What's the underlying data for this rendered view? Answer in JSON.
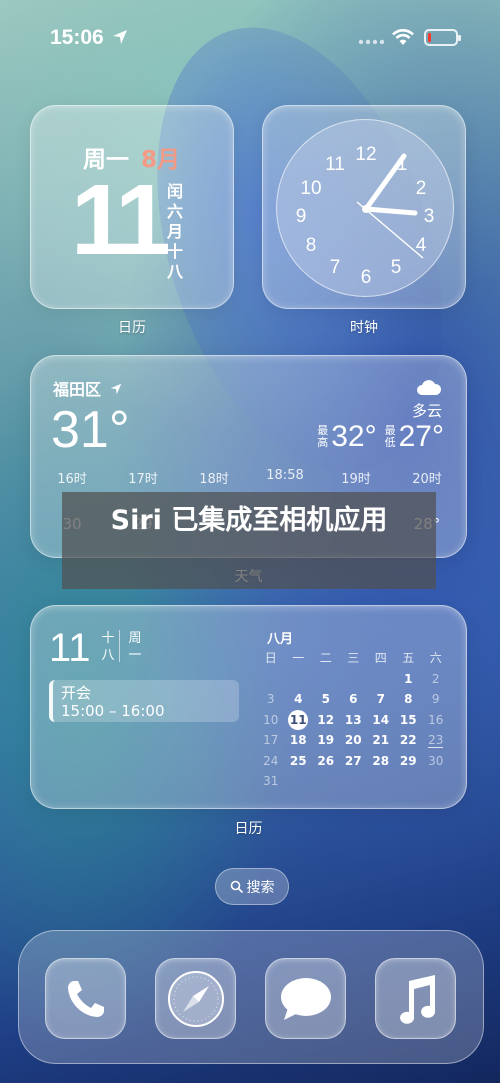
{
  "status_bar": {
    "time": "15:06"
  },
  "calendar_widget": {
    "weekday": "周一",
    "month": "8月",
    "day": "11",
    "lunar": [
      "闰",
      "六",
      "月",
      "十",
      "八"
    ],
    "label": "日历"
  },
  "clock_widget": {
    "numbers": [
      "12",
      "1",
      "2",
      "3",
      "4",
      "5",
      "6",
      "7",
      "8",
      "9",
      "10",
      "11"
    ],
    "label": "时钟"
  },
  "weather_widget": {
    "city": "福田区",
    "temperature": "31°",
    "condition": "多云",
    "high_tag": "最高",
    "high": "32°",
    "low_tag": "最低",
    "low": "27°",
    "hours": [
      {
        "time": "16时",
        "temp": "30"
      },
      {
        "time": "17时",
        "temp": "29"
      },
      {
        "time": "18时",
        "temp": ""
      },
      {
        "time": "18:58",
        "temp": ""
      },
      {
        "time": "19时",
        "temp": ""
      },
      {
        "time": "20时",
        "temp": "28°"
      }
    ],
    "label": "天气"
  },
  "banner": {
    "text": "Siri 已集成至相机应用"
  },
  "calendar_large": {
    "day": "11",
    "lunar": [
      "十",
      "八"
    ],
    "week": [
      "周",
      "一"
    ],
    "event_title": "开会",
    "event_time": "15:00 – 16:00",
    "month": "八月",
    "headers": [
      "日",
      "一",
      "二",
      "三",
      "四",
      "五",
      "六"
    ],
    "rows": [
      [
        "",
        "",
        "",
        "",
        "",
        "1",
        "2"
      ],
      [
        "3",
        "4",
        "5",
        "6",
        "7",
        "8",
        "9"
      ],
      [
        "10",
        "11",
        "12",
        "13",
        "14",
        "15",
        "16"
      ],
      [
        "17",
        "18",
        "19",
        "20",
        "21",
        "22",
        "23"
      ],
      [
        "24",
        "25",
        "26",
        "27",
        "28",
        "29",
        "30"
      ],
      [
        "31",
        "",
        "",
        "",
        "",
        "",
        ""
      ]
    ],
    "today": "11",
    "label": "日历"
  },
  "search": {
    "label": "搜索"
  },
  "dock": {
    "apps": [
      "phone-app",
      "safari-app",
      "messages-app",
      "music-app"
    ]
  }
}
